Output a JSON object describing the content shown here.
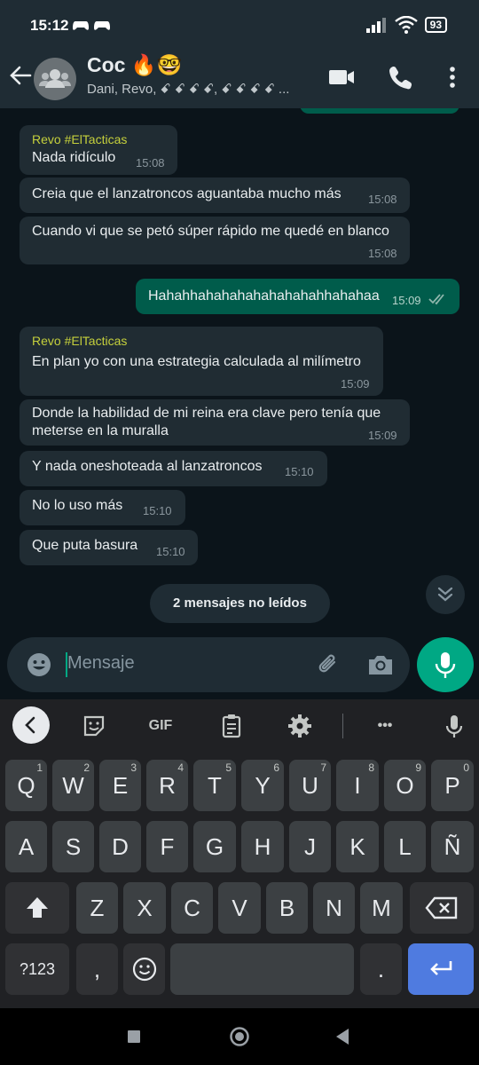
{
  "status_bar": {
    "time": "15:12",
    "battery": "93"
  },
  "header": {
    "title": "Coc 🔥🤓",
    "subtitle": "Dani, Revo, ꗃ ꗃ ꗃ ꗃ, ꗃ ꗃ ꗃ ꗃ ..."
  },
  "messages": [
    {
      "sender": "Revo #ElTacticas",
      "text": "Nada ridículo",
      "time": "15:08"
    },
    {
      "text": "Creia que el lanzatroncos aguantaba mucho más",
      "time": "15:08"
    },
    {
      "text": "Cuando vi que se petó súper rápido me quedé en blanco",
      "time": "15:08"
    },
    {
      "text": "Hahahhahahahahahahahahhahahaa",
      "time": "15:09"
    },
    {
      "sender": "Revo #ElTacticas",
      "text": "En plan yo con una estrategia calculada al milímetro",
      "time": "15:09"
    },
    {
      "text_line1": "Donde la habilidad de mi reina era clave pero tenía que",
      "text_line2": "meterse en la muralla",
      "time": "15:09"
    },
    {
      "text": "Y nada oneshoteada al lanzatroncos",
      "time": "15:10"
    },
    {
      "text": "No lo uso más",
      "time": "15:10"
    },
    {
      "text": "Que puta basura",
      "time": "15:10"
    }
  ],
  "unread_pill": "2 mensajes no leídos",
  "composer": {
    "placeholder": "Mensaje"
  },
  "keyboard": {
    "toolbar": {
      "gif": "GIF",
      "more": "•••"
    },
    "row1": [
      {
        "k": "Q",
        "h": "1"
      },
      {
        "k": "W",
        "h": "2"
      },
      {
        "k": "E",
        "h": "3"
      },
      {
        "k": "R",
        "h": "4"
      },
      {
        "k": "T",
        "h": "5"
      },
      {
        "k": "Y",
        "h": "6"
      },
      {
        "k": "U",
        "h": "7"
      },
      {
        "k": "I",
        "h": "8"
      },
      {
        "k": "O",
        "h": "9"
      },
      {
        "k": "P",
        "h": "0"
      }
    ],
    "row2": [
      "A",
      "S",
      "D",
      "F",
      "G",
      "H",
      "J",
      "K",
      "L",
      "Ñ"
    ],
    "row3": [
      "Z",
      "X",
      "C",
      "V",
      "B",
      "N",
      "M"
    ],
    "symbols": "?123",
    "comma": ",",
    "period": "."
  },
  "colors": {
    "accent": "#00a884",
    "outgoing": "#005c4b",
    "incoming": "#202c33",
    "sender": "#c5d03c"
  }
}
